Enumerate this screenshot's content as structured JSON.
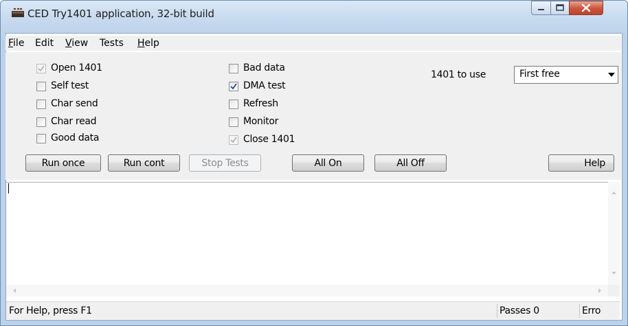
{
  "window": {
    "title": "CED Try1401 application, 32-bit build"
  },
  "menu": [
    "File",
    "Edit",
    "View",
    "Tests",
    "Help"
  ],
  "checkboxes_left": [
    {
      "label": "Open 1401",
      "checked": true,
      "disabled": true
    },
    {
      "label": "Self test",
      "checked": false,
      "disabled": false
    },
    {
      "label": "Char send",
      "checked": false,
      "disabled": false
    },
    {
      "label": "Char read",
      "checked": false,
      "disabled": false
    },
    {
      "label": "Good data",
      "checked": false,
      "disabled": false
    }
  ],
  "checkboxes_right": [
    {
      "label": "Bad data",
      "checked": false,
      "disabled": false
    },
    {
      "label": "DMA test",
      "checked": true,
      "disabled": false
    },
    {
      "label": "Refresh",
      "checked": false,
      "disabled": false
    },
    {
      "label": "Monitor",
      "checked": false,
      "disabled": false
    },
    {
      "label": "Close 1401",
      "checked": true,
      "disabled": true
    }
  ],
  "device_label": "1401 to use",
  "device_select": "First free",
  "buttons": {
    "run_once": "Run once",
    "run_cont": "Run cont",
    "stop_tests": "Stop Tests",
    "all_on": "All On",
    "all_off": "All Off",
    "help": "Help"
  },
  "status": {
    "help_text": "For Help, press F1",
    "passes": "Passes 0",
    "errors": "Erro"
  }
}
